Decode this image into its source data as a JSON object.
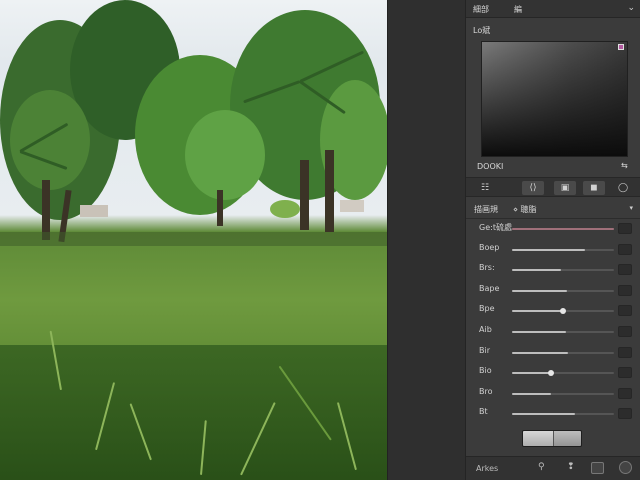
{
  "panel": {
    "header": {
      "tab1": "細部",
      "tab2": "編",
      "close_glyph": "⌄"
    },
    "picker_label": "Lo斌",
    "readout": "DOOKI",
    "readout_icon": "⇆",
    "tools": [
      {
        "glyph": "☷",
        "name": "grid"
      },
      {
        "glyph": "⟨⟩",
        "name": "code"
      },
      {
        "glyph": "▣",
        "name": "square"
      },
      {
        "glyph": "◼",
        "name": "fill-square"
      },
      {
        "glyph": "◯",
        "name": "circle"
      }
    ],
    "section": {
      "name": "描画規",
      "value": "⋄ 聴脂",
      "caret": "▾"
    },
    "sliders": [
      {
        "label": "Ge:t硫處",
        "value": 1.0,
        "knob": false
      },
      {
        "label": "Boep",
        "value": 0.72,
        "knob": false
      },
      {
        "label": "Brs:",
        "value": 0.48,
        "knob": false
      },
      {
        "label": "Bape",
        "value": 0.54,
        "knob": false
      },
      {
        "label": "Bpe",
        "value": 0.5,
        "knob": true
      },
      {
        "label": "Aib",
        "value": 0.53,
        "knob": false
      },
      {
        "label": "Bir",
        "value": 0.55,
        "knob": false
      },
      {
        "label": "Bio",
        "value": 0.38,
        "knob": true
      },
      {
        "label": "Bro",
        "value": 0.38,
        "knob": false
      },
      {
        "label": "Bt",
        "value": 0.62,
        "knob": false
      }
    ],
    "footer": {
      "text": "Arkes",
      "icon1": "⚲",
      "icon2": "❢"
    }
  },
  "colors": {
    "accent": "#b35aa0",
    "panel_bg": "#3b3b3b",
    "gutter_bg": "#2f2f2f"
  }
}
